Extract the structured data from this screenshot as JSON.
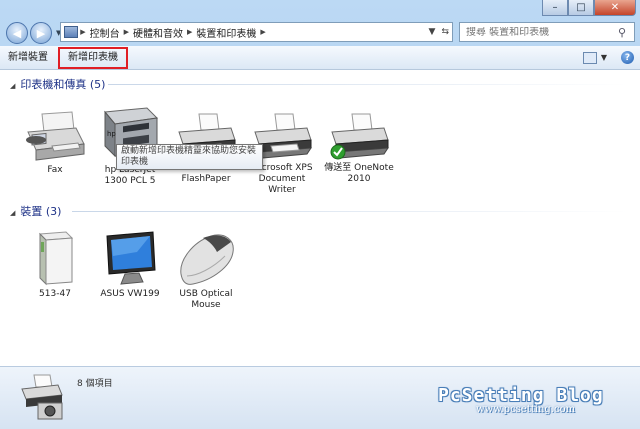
{
  "address": {
    "crumbs": [
      "控制台",
      "硬體和音效",
      "裝置和印表機"
    ],
    "search_placeholder": "搜尋 裝置和印表機"
  },
  "toolbar": {
    "add_device": "新增裝置",
    "add_printer": "新增印表機"
  },
  "tooltip": "啟動新增印表機精靈來協助您安裝印表機",
  "groups": {
    "printers": {
      "title": "印表機和傳真 (5)",
      "items": [
        {
          "label": "Fax",
          "icon": "fax-icon"
        },
        {
          "label": "hp LaserJet 1300 PCL 5",
          "icon": "laser-printer-icon"
        },
        {
          "label": "Macromedia FlashPaper",
          "icon": "printer-icon"
        },
        {
          "label": "Microsoft XPS Document Writer",
          "icon": "printer-icon"
        },
        {
          "label": "傳送至 OneNote 2010",
          "icon": "default-printer-icon"
        }
      ]
    },
    "devices": {
      "title": "裝置 (3)",
      "items": [
        {
          "label": "513-47",
          "icon": "computer-tower-icon"
        },
        {
          "label": "ASUS VW199",
          "icon": "monitor-icon"
        },
        {
          "label": "USB Optical Mouse",
          "icon": "mouse-icon"
        }
      ]
    }
  },
  "status": {
    "count": "8 個項目"
  },
  "watermark": {
    "line1": "PcSetting Blog",
    "line2": "www.pcsetting.com"
  },
  "colors": {
    "highlight_border": "#e01e25",
    "group_title": "#1e3287",
    "window_chrome": "#bcd9f4"
  }
}
